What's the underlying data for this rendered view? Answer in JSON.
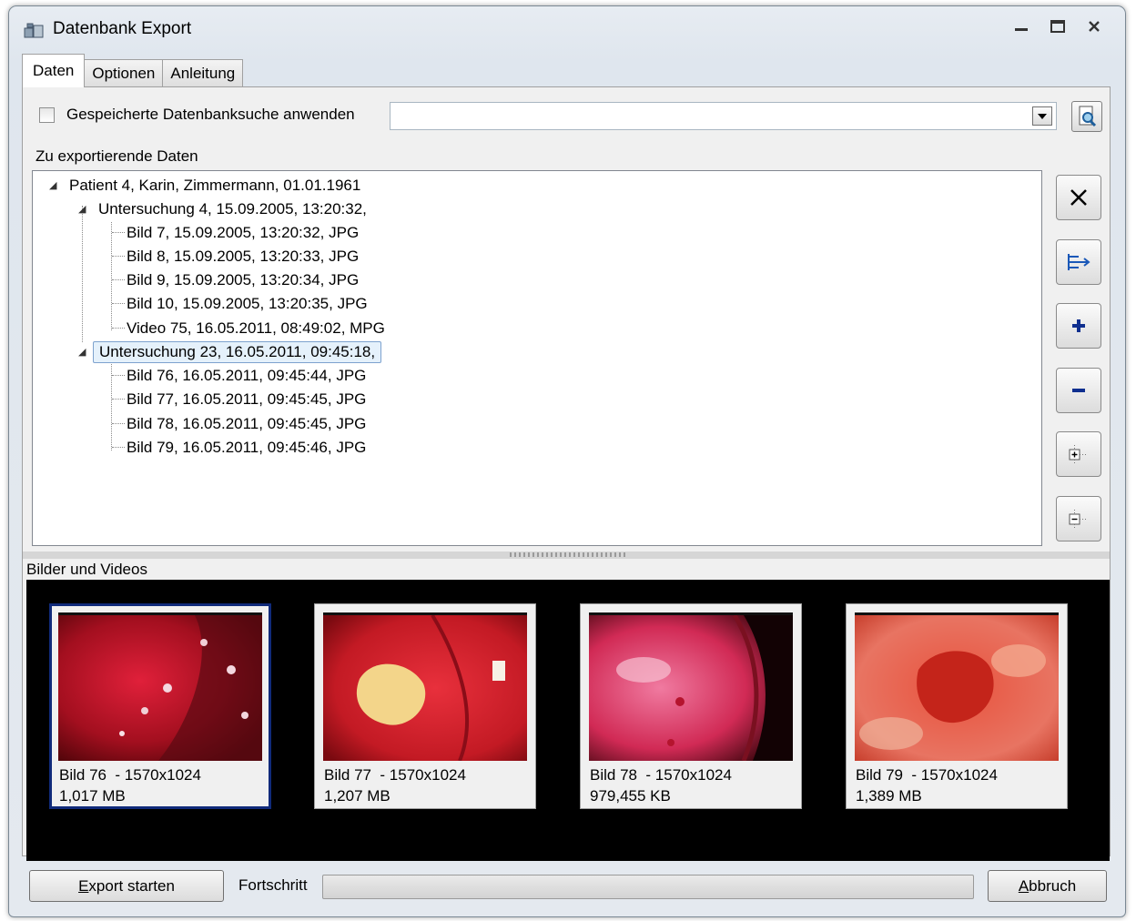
{
  "window": {
    "title": "Datenbank Export",
    "controls": [
      "minimize",
      "maximize",
      "close"
    ]
  },
  "tabs": [
    {
      "label": "Daten",
      "active": true
    },
    {
      "label": "Optionen",
      "active": false
    },
    {
      "label": "Anleitung",
      "active": false
    }
  ],
  "search": {
    "checkbox_label": "Gespeicherte Datenbanksuche anwenden",
    "checked": false,
    "combo_value": ""
  },
  "tree": {
    "section_label": "Zu exportierende Daten",
    "patient": "Patient 4, Karin, Zimmermann, 01.01.1961",
    "exam1": {
      "label": "Untersuchung 4, 15.09.2005, 13:20:32,",
      "items": [
        "Bild 7, 15.09.2005, 13:20:32, JPG",
        "Bild 8, 15.09.2005, 13:20:33, JPG",
        "Bild 9, 15.09.2005, 13:20:34, JPG",
        "Bild 10, 15.09.2005, 13:20:35, JPG",
        "Video 75, 16.05.2011, 08:49:02, MPG"
      ]
    },
    "exam2": {
      "label": "Untersuchung 23, 16.05.2011, 09:45:18,",
      "selected": true,
      "items": [
        "Bild 76, 16.05.2011, 09:45:44, JPG",
        "Bild 77, 16.05.2011, 09:45:45, JPG",
        "Bild 78, 16.05.2011, 09:45:45, JPG",
        "Bild 79, 16.05.2011, 09:45:46, JPG"
      ]
    }
  },
  "side_buttons": [
    "close-x-icon",
    "export-arrow-icon",
    "plus-icon",
    "minus-icon",
    "expand-tree-icon",
    "collapse-tree-icon"
  ],
  "gallery": {
    "label": "Bilder und Videos",
    "thumbs": [
      {
        "line1": "Bild 76  - 1570x1024",
        "line2": "1,017 MB",
        "selected": true
      },
      {
        "line1": "Bild 77  - 1570x1024",
        "line2": "1,207 MB",
        "selected": false
      },
      {
        "line1": "Bild 78  - 1570x1024",
        "line2": "979,455 KB",
        "selected": false
      },
      {
        "line1": "Bild 79  - 1570x1024",
        "line2": "1,389 MB",
        "selected": false
      }
    ]
  },
  "footer": {
    "export_label_prefix": "E",
    "export_label_rest": "xport starten",
    "progress_label": "Fortschritt",
    "progress_value": 0,
    "cancel_label_prefix": "A",
    "cancel_label_rest": "bbruch"
  },
  "colors": {
    "selection_border": "#102a7a",
    "tree_selection": "#e5f1fb",
    "gallery_bg": "#000000"
  }
}
